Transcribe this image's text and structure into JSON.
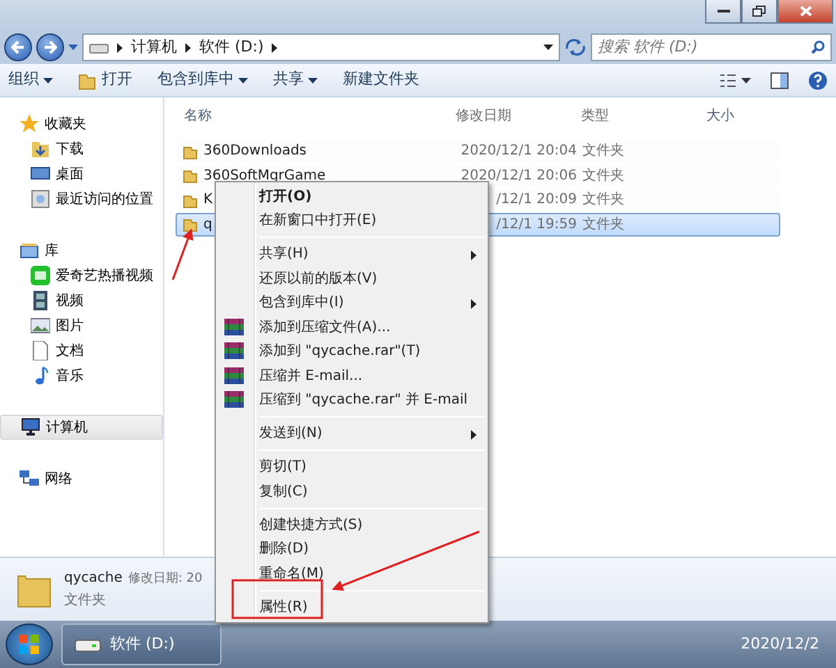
{
  "address": {
    "crumbs": [
      "计算机",
      "软件 (D:)"
    ]
  },
  "search": {
    "placeholder": "搜索 软件 (D:)"
  },
  "toolbar": [
    {
      "label": "组织",
      "dropdown": true
    },
    {
      "label": "打开",
      "dropdown": false
    },
    {
      "label": "包含到库中",
      "dropdown": true
    },
    {
      "label": "共享",
      "dropdown": true
    },
    {
      "label": "新建文件夹",
      "dropdown": false
    }
  ],
  "sidebar": [
    {
      "label": "收藏夹",
      "selected": false,
      "children": [
        {
          "label": "下载",
          "selected": false
        },
        {
          "label": "桌面",
          "selected": false
        },
        {
          "label": "最近访问的位置",
          "selected": false
        }
      ]
    },
    {
      "label": "库",
      "selected": false,
      "children": [
        {
          "label": "爱奇艺热播视频",
          "selected": false
        },
        {
          "label": "视频",
          "selected": false
        },
        {
          "label": "图片",
          "selected": false
        },
        {
          "label": "文档",
          "selected": false
        },
        {
          "label": "音乐",
          "selected": false
        }
      ]
    },
    {
      "label": "计算机",
      "selected": true
    },
    {
      "label": "网络",
      "selected": false
    }
  ],
  "table": {
    "columns": [
      "名称",
      "修改日期",
      "类型",
      "大小"
    ],
    "rows": [
      {
        "name": "360Downloads",
        "date": "2020/12/1 20:04",
        "type": "文件夹",
        "selected": false
      },
      {
        "name": "360SoftMgrGame",
        "date": "2020/12/1 20:06",
        "type": "文件夹",
        "selected": false
      },
      {
        "name": "K",
        "date": "/12/1 20:09",
        "type": "文件夹",
        "selected": false
      },
      {
        "name": "q",
        "date": "/12/1 19:59",
        "type": "文件夹",
        "selected": true
      }
    ]
  },
  "details": {
    "name": "qycache",
    "meta": "修改日期: 20",
    "type": "文件夹"
  },
  "context_menu": [
    {
      "kind": "item",
      "label": "打开(O)",
      "default": true,
      "submenu": false,
      "archive": false
    },
    {
      "kind": "item",
      "label": "在新窗口中打开(E)",
      "default": false,
      "submenu": false,
      "archive": false
    },
    {
      "kind": "separator"
    },
    {
      "kind": "item",
      "label": "共享(H)",
      "default": false,
      "submenu": true,
      "archive": false
    },
    {
      "kind": "item",
      "label": "还原以前的版本(V)",
      "default": false,
      "submenu": false,
      "archive": false
    },
    {
      "kind": "item",
      "label": "包含到库中(I)",
      "default": false,
      "submenu": true,
      "archive": false
    },
    {
      "kind": "item",
      "label": "添加到压缩文件(A)...",
      "default": false,
      "submenu": false,
      "archive": true
    },
    {
      "kind": "item",
      "label": "添加到 \"qycache.rar\"(T)",
      "default": false,
      "submenu": false,
      "archive": true
    },
    {
      "kind": "item",
      "label": "压缩并 E-mail...",
      "default": false,
      "submenu": false,
      "archive": true
    },
    {
      "kind": "item",
      "label": "压缩到 \"qycache.rar\" 并 E-mail",
      "default": false,
      "submenu": false,
      "archive": true
    },
    {
      "kind": "separator"
    },
    {
      "kind": "item",
      "label": "发送到(N)",
      "default": false,
      "submenu": true,
      "archive": false
    },
    {
      "kind": "separator"
    },
    {
      "kind": "item",
      "label": "剪切(T)",
      "default": false,
      "submenu": false,
      "archive": false
    },
    {
      "kind": "item",
      "label": "复制(C)",
      "default": false,
      "submenu": false,
      "archive": false
    },
    {
      "kind": "separator"
    },
    {
      "kind": "item",
      "label": "创建快捷方式(S)",
      "default": false,
      "submenu": false,
      "archive": false
    },
    {
      "kind": "item",
      "label": "删除(D)",
      "default": false,
      "submenu": false,
      "archive": false
    },
    {
      "kind": "item",
      "label": "重命名(M)",
      "default": false,
      "submenu": false,
      "archive": false
    },
    {
      "kind": "separator"
    },
    {
      "kind": "item",
      "label": "属性(R)",
      "default": false,
      "submenu": false,
      "archive": false
    }
  ],
  "annotations": [
    {
      "kind": "arrow"
    },
    {
      "kind": "arrow"
    },
    {
      "kind": "frame"
    }
  ],
  "taskbar": {
    "window": "软件 (D:)",
    "date": "2020/12/2"
  }
}
